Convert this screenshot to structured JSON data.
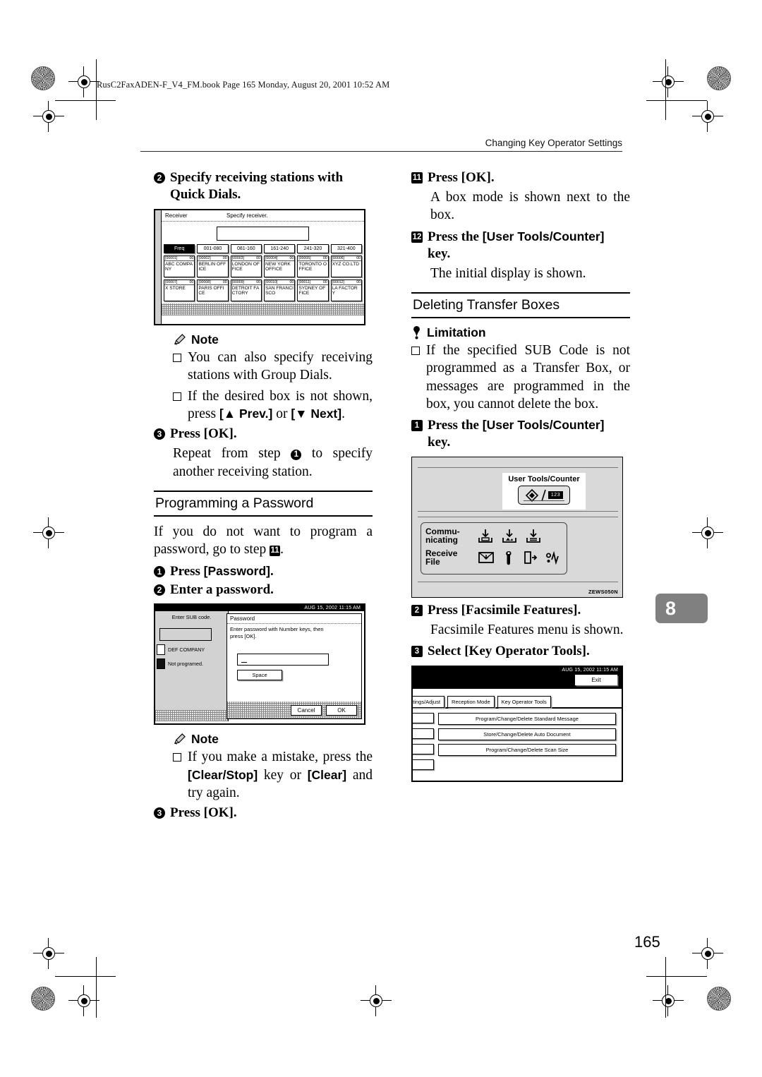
{
  "page": {
    "filestamp": "RusC2FaxADEN-F_V4_FM.book  Page 165  Monday, August 20, 2001  10:52 AM",
    "running_head": "Changing Key Operator Settings",
    "folio": "165",
    "chapter_tab": "8"
  },
  "left_column": {
    "step2": {
      "num": "2",
      "text": "Specify receiving stations with Quick Dials."
    },
    "figure_receiver": {
      "title_label": "Receiver",
      "instruction": "Specify receiver.",
      "tabs": [
        "Freq",
        "001-080",
        "081-160",
        "161-240",
        "241-320",
        "321-400"
      ],
      "selected_tab": "Freq",
      "entries": [
        {
          "id": "[00001]",
          "badge": "00",
          "name": "ABC COMPANY"
        },
        {
          "id": "[00002]",
          "badge": "00",
          "name": "BERLIN OFFICE"
        },
        {
          "id": "[00003]",
          "badge": "00",
          "name": "LONDON OFFICE"
        },
        {
          "id": "[00004]",
          "badge": "00",
          "name": "NEW YORK OFFICE"
        },
        {
          "id": "[00005]",
          "badge": "00",
          "name": "TORONTO OFFICE"
        },
        {
          "id": "[00006]",
          "badge": "00",
          "name": "XYZ CO.LTD"
        },
        {
          "id": "[00007]",
          "badge": "00",
          "name": "X STORE"
        },
        {
          "id": "[00008]",
          "badge": "00",
          "name": "PARIS OFFICE"
        },
        {
          "id": "[00009]",
          "badge": "00",
          "name": "DETROIT FACTORY"
        },
        {
          "id": "[00010]",
          "badge": "00",
          "name": "SAN FRANCISCO"
        },
        {
          "id": "[00011]",
          "badge": "00",
          "name": "SYDNEY OFFICE"
        },
        {
          "id": "[00012]",
          "badge": "00",
          "name": "LA FACTORY"
        }
      ]
    },
    "note1": {
      "heading": "Note",
      "bullet1": "You can also specify receiving stations with Group Dials.",
      "bullet2_a": "If the desired box is not shown, press ",
      "bullet2_key1": "[▲ Prev.]",
      "bullet2_b": " or ",
      "bullet2_key2": "[▼ Next]",
      "bullet2_c": "."
    },
    "step3": {
      "num": "3",
      "text": "Press [OK]."
    },
    "step3_body_a": "Repeat from step ",
    "step3_body_num": "1",
    "step3_body_b": " to specify another receiving station.",
    "password_section": {
      "heading": "Programming a Password",
      "intro_a": "If you do not want to program a password, go to step ",
      "intro_num": "11",
      "intro_b": ".",
      "step1": {
        "num": "1",
        "text_a": "Press ",
        "key": "[Password]",
        "text_b": "."
      },
      "step2": {
        "num": "2",
        "text": "Enter a password."
      }
    },
    "figure_password": {
      "clock": "AUG 15, 2002  11:15 AM",
      "left_caption": "Enter SUB code.",
      "entry1": "DEF COMPANY",
      "entry2": "Not programed.",
      "dialog_title": "Password",
      "dialog_instruction_line1": "Enter password with Number keys, then",
      "dialog_instruction_line2": "press [OK].",
      "space_button": "Space",
      "cancel_button": "Cancel",
      "ok_button": "OK"
    },
    "note2": {
      "heading": "Note",
      "bullet_a": "If you make a mistake, press the ",
      "bullet_key1": "[Clear/Stop]",
      "bullet_b": " key or ",
      "bullet_key2": "[Clear]",
      "bullet_c": " and try again."
    },
    "step3b": {
      "num": "3",
      "text": "Press [OK]."
    }
  },
  "right_column": {
    "step11": {
      "num": "11",
      "text": "Press [OK]."
    },
    "step11_body": "A box mode is shown next to the box.",
    "step12": {
      "num": "12",
      "text_a": "Press the ",
      "key": "[User Tools/Counter]",
      "text_b": " key."
    },
    "step12_body": "The initial display is shown.",
    "section_heading": "Deleting Transfer Boxes",
    "limitation": {
      "heading": "Limitation",
      "bullet": "If the specified SUB Code is not programmed as a Transfer Box, or messages are programmed in the box, you cannot delete the box."
    },
    "step1": {
      "num": "1",
      "text_a": "Press the ",
      "key": "[User Tools/Counter]",
      "text_b": " key."
    },
    "figure_panel": {
      "button_label": "User Tools/Counter",
      "indicator1": "Commu-nicating",
      "indicator1_line1": "Commu-",
      "indicator1_line2": "nicating",
      "indicator2_line1": "Receive",
      "indicator2_line2": "File",
      "figure_code": "ZEWS050N",
      "counter_glyph": "123"
    },
    "step2": {
      "num": "2",
      "text": "Press [Facsimile Features]."
    },
    "step2_body": "Facsimile Features menu is shown.",
    "step3": {
      "num": "3",
      "text": "Select [Key Operator Tools]."
    },
    "figure_keyop": {
      "clock": "AUG 15, 2002  11:15 AM",
      "exit_button": "Exit",
      "tabs": [
        "ettings/Adjust",
        "Reception Mode",
        "Key Operator Tools"
      ],
      "selected_tab": "Key Operator Tools",
      "menu_items": [
        "Program/Change/Delete Standard Message",
        "Store/Change/Delete Auto Document",
        "Program/Change/Delete Scan Size"
      ]
    }
  }
}
